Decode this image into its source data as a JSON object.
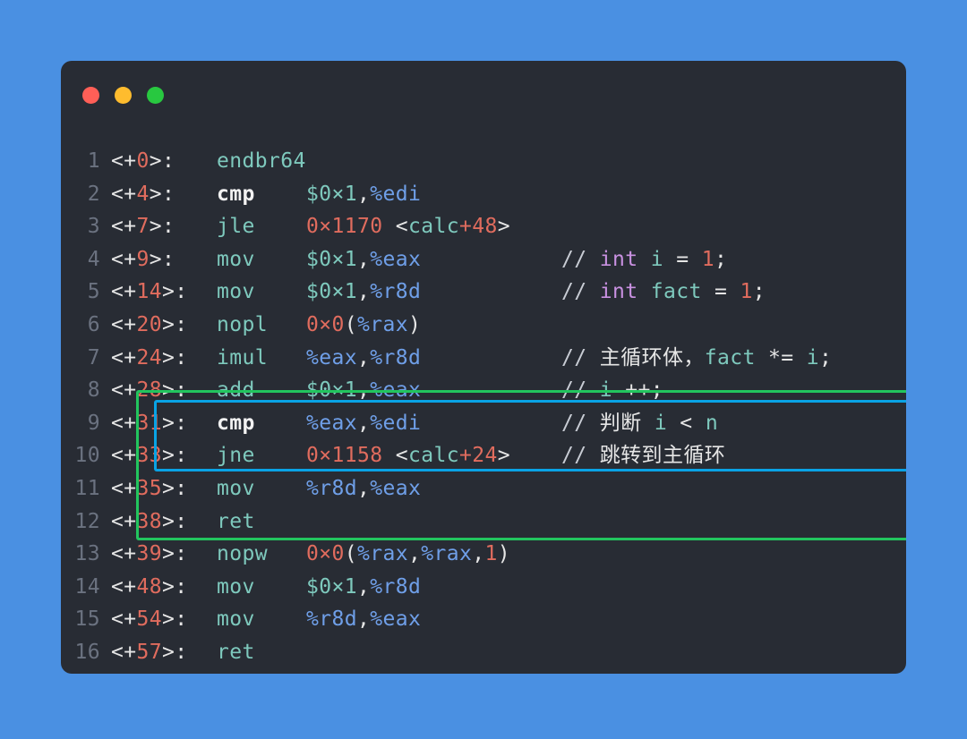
{
  "window": {
    "traffic_lights": [
      {
        "name": "close",
        "color": "#ff5f57"
      },
      {
        "name": "minimize",
        "color": "#febc2e"
      },
      {
        "name": "zoom",
        "color": "#28c840"
      }
    ],
    "background_color": "#4a90e2",
    "card_color": "#282c34"
  },
  "highlights": [
    {
      "name": "loop-body-box",
      "color": "#09a3e5",
      "lines": [
        7,
        8
      ]
    },
    {
      "name": "loop-region-box",
      "color": "#22c55e",
      "lines": [
        7,
        8,
        9,
        10
      ]
    }
  ],
  "code": {
    "language": "x86-64 assembly (AT&T syntax)",
    "lines": [
      {
        "n": "1",
        "addr_prefix": "<+",
        "addr_num": "0",
        "addr_suffix": ">:",
        "mnemonic": "endbr64",
        "mnemonic_style": "teal",
        "operands": [],
        "comment": []
      },
      {
        "n": "2",
        "addr_prefix": "<+",
        "addr_num": "4",
        "addr_suffix": ">:",
        "mnemonic": "cmp",
        "mnemonic_style": "white",
        "operands": [
          {
            "t": "imm",
            "v": "$0×1"
          },
          {
            "t": "pun",
            "v": ","
          },
          {
            "t": "reg",
            "v": "%edi"
          }
        ],
        "comment": []
      },
      {
        "n": "3",
        "addr_prefix": "<+",
        "addr_num": "7",
        "addr_suffix": ">:",
        "mnemonic": "jle",
        "mnemonic_style": "teal",
        "operands": [
          {
            "t": "num",
            "v": "0×1170"
          },
          {
            "t": "pun",
            "v": " <"
          },
          {
            "t": "sym",
            "v": "calc"
          },
          {
            "t": "num",
            "v": "+48"
          },
          {
            "t": "pun",
            "v": ">"
          }
        ],
        "comment": []
      },
      {
        "n": "4",
        "addr_prefix": "<+",
        "addr_num": "9",
        "addr_suffix": ">:",
        "mnemonic": "mov",
        "mnemonic_style": "teal",
        "operands": [
          {
            "t": "imm",
            "v": "$0×1"
          },
          {
            "t": "pun",
            "v": ","
          },
          {
            "t": "reg",
            "v": "%eax"
          }
        ],
        "comment": [
          {
            "t": "slash",
            "v": "// "
          },
          {
            "t": "kw",
            "v": "int"
          },
          {
            "t": "op",
            "v": " "
          },
          {
            "t": "var",
            "v": "i"
          },
          {
            "t": "op",
            "v": " = "
          },
          {
            "t": "lit",
            "v": "1"
          },
          {
            "t": "op",
            "v": ";"
          }
        ]
      },
      {
        "n": "5",
        "addr_prefix": "<+",
        "addr_num": "14",
        "addr_suffix": ">:",
        "mnemonic": "mov",
        "mnemonic_style": "teal",
        "operands": [
          {
            "t": "imm",
            "v": "$0×1"
          },
          {
            "t": "pun",
            "v": ","
          },
          {
            "t": "reg",
            "v": "%r8d"
          }
        ],
        "comment": [
          {
            "t": "slash",
            "v": "// "
          },
          {
            "t": "kw",
            "v": "int"
          },
          {
            "t": "op",
            "v": " "
          },
          {
            "t": "var",
            "v": "fact"
          },
          {
            "t": "op",
            "v": " = "
          },
          {
            "t": "lit",
            "v": "1"
          },
          {
            "t": "op",
            "v": ";"
          }
        ]
      },
      {
        "n": "6",
        "addr_prefix": "<+",
        "addr_num": "20",
        "addr_suffix": ">:",
        "mnemonic": "nopl",
        "mnemonic_style": "teal",
        "operands": [
          {
            "t": "num",
            "v": "0×0"
          },
          {
            "t": "pun",
            "v": "("
          },
          {
            "t": "reg",
            "v": "%rax"
          },
          {
            "t": "pun",
            "v": ")"
          }
        ],
        "comment": []
      },
      {
        "n": "7",
        "addr_prefix": "<+",
        "addr_num": "24",
        "addr_suffix": ">:",
        "mnemonic": "imul",
        "mnemonic_style": "teal",
        "operands": [
          {
            "t": "reg",
            "v": "%eax"
          },
          {
            "t": "pun",
            "v": ","
          },
          {
            "t": "reg",
            "v": "%r8d"
          }
        ],
        "comment": [
          {
            "t": "slash",
            "v": "// "
          },
          {
            "t": "cn",
            "v": "主循环体，"
          },
          {
            "t": "var",
            "v": "fact"
          },
          {
            "t": "op",
            "v": " *= "
          },
          {
            "t": "var",
            "v": "i"
          },
          {
            "t": "op",
            "v": ";"
          }
        ]
      },
      {
        "n": "8",
        "addr_prefix": "<+",
        "addr_num": "28",
        "addr_suffix": ">:",
        "mnemonic": "add",
        "mnemonic_style": "teal",
        "operands": [
          {
            "t": "imm",
            "v": "$0×1"
          },
          {
            "t": "pun",
            "v": ","
          },
          {
            "t": "reg",
            "v": "%eax"
          }
        ],
        "comment": [
          {
            "t": "slash",
            "v": "// "
          },
          {
            "t": "var",
            "v": "i"
          },
          {
            "t": "op",
            "v": " ++;"
          }
        ]
      },
      {
        "n": "9",
        "addr_prefix": "<+",
        "addr_num": "31",
        "addr_suffix": ">:",
        "mnemonic": "cmp",
        "mnemonic_style": "white",
        "operands": [
          {
            "t": "reg",
            "v": "%eax"
          },
          {
            "t": "pun",
            "v": ","
          },
          {
            "t": "reg",
            "v": "%edi"
          }
        ],
        "comment": [
          {
            "t": "slash",
            "v": "// "
          },
          {
            "t": "cn",
            "v": "判断 "
          },
          {
            "t": "var",
            "v": "i"
          },
          {
            "t": "op",
            "v": " < "
          },
          {
            "t": "var",
            "v": "n"
          }
        ]
      },
      {
        "n": "10",
        "addr_prefix": "<+",
        "addr_num": "33",
        "addr_suffix": ">:",
        "mnemonic": "jne",
        "mnemonic_style": "teal",
        "operands": [
          {
            "t": "num",
            "v": "0×1158"
          },
          {
            "t": "pun",
            "v": " <"
          },
          {
            "t": "sym",
            "v": "calc"
          },
          {
            "t": "num",
            "v": "+24"
          },
          {
            "t": "pun",
            "v": ">"
          }
        ],
        "comment": [
          {
            "t": "slash",
            "v": "// "
          },
          {
            "t": "cn",
            "v": "跳转到主循环"
          }
        ]
      },
      {
        "n": "11",
        "addr_prefix": "<+",
        "addr_num": "35",
        "addr_suffix": ">:",
        "mnemonic": "mov",
        "mnemonic_style": "teal",
        "operands": [
          {
            "t": "reg",
            "v": "%r8d"
          },
          {
            "t": "pun",
            "v": ","
          },
          {
            "t": "reg",
            "v": "%eax"
          }
        ],
        "comment": []
      },
      {
        "n": "12",
        "addr_prefix": "<+",
        "addr_num": "38",
        "addr_suffix": ">:",
        "mnemonic": "ret",
        "mnemonic_style": "teal",
        "operands": [],
        "comment": []
      },
      {
        "n": "13",
        "addr_prefix": "<+",
        "addr_num": "39",
        "addr_suffix": ">:",
        "mnemonic": "nopw",
        "mnemonic_style": "teal",
        "operands": [
          {
            "t": "num",
            "v": "0×0"
          },
          {
            "t": "pun",
            "v": "("
          },
          {
            "t": "reg",
            "v": "%rax"
          },
          {
            "t": "pun",
            "v": ","
          },
          {
            "t": "reg",
            "v": "%rax"
          },
          {
            "t": "pun",
            "v": ","
          },
          {
            "t": "num",
            "v": "1"
          },
          {
            "t": "pun",
            "v": ")"
          }
        ],
        "comment": []
      },
      {
        "n": "14",
        "addr_prefix": "<+",
        "addr_num": "48",
        "addr_suffix": ">:",
        "mnemonic": "mov",
        "mnemonic_style": "teal",
        "operands": [
          {
            "t": "imm",
            "v": "$0×1"
          },
          {
            "t": "pun",
            "v": ","
          },
          {
            "t": "reg",
            "v": "%r8d"
          }
        ],
        "comment": []
      },
      {
        "n": "15",
        "addr_prefix": "<+",
        "addr_num": "54",
        "addr_suffix": ">:",
        "mnemonic": "mov",
        "mnemonic_style": "teal",
        "operands": [
          {
            "t": "reg",
            "v": "%r8d"
          },
          {
            "t": "pun",
            "v": ","
          },
          {
            "t": "reg",
            "v": "%eax"
          }
        ],
        "comment": []
      },
      {
        "n": "16",
        "addr_prefix": "<+",
        "addr_num": "57",
        "addr_suffix": ">:",
        "mnemonic": "ret",
        "mnemonic_style": "teal",
        "operands": [],
        "comment": []
      }
    ]
  }
}
